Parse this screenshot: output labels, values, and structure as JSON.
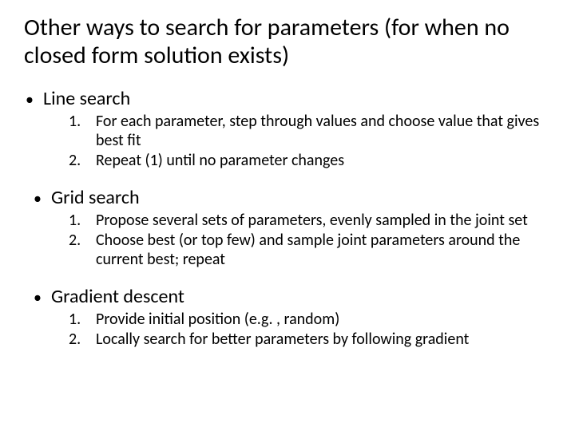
{
  "title": "Other ways to search for parameters (for when no closed form solution exists)",
  "bulletChar": "•",
  "sections": [
    {
      "label": "Line search",
      "items": [
        {
          "num": "1.",
          "text": "For each parameter, step through values and choose value that gives best fit"
        },
        {
          "num": "2.",
          "text": "Repeat (1) until no parameter changes"
        }
      ]
    },
    {
      "label": "Grid search",
      "items": [
        {
          "num": "1.",
          "text": "Propose several sets of parameters, evenly sampled in the joint set"
        },
        {
          "num": "2.",
          "text": "Choose best (or top few) and sample joint parameters around the current best; repeat"
        }
      ]
    },
    {
      "label": "Gradient descent",
      "items": [
        {
          "num": "1.",
          "text": "Provide initial position (e.g. , random)"
        },
        {
          "num": "2.",
          "text": "Locally search for better parameters by following gradient"
        }
      ]
    }
  ]
}
